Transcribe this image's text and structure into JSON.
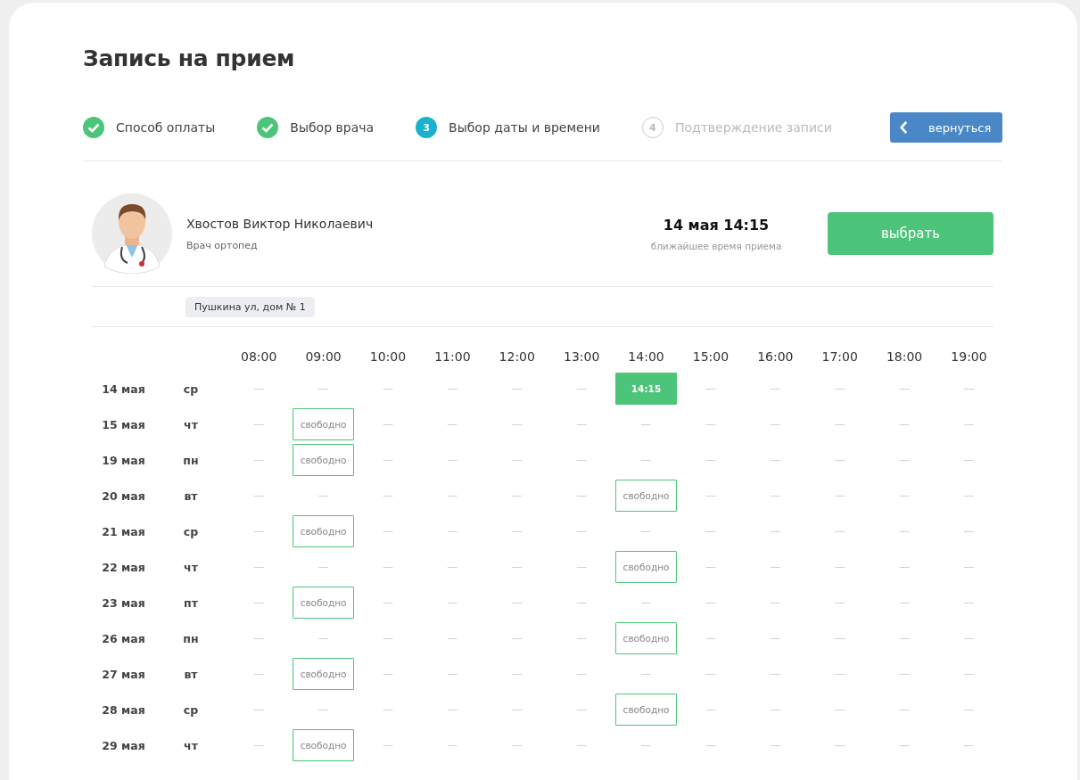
{
  "title": "Запись на прием",
  "steps": [
    {
      "label": "Способ оплаты",
      "kind": "done"
    },
    {
      "label": "Выбор врача",
      "kind": "done"
    },
    {
      "label": "Выбор даты и времени",
      "kind": "current",
      "number": "3"
    },
    {
      "label": "Подтверждение записи",
      "kind": "upcoming",
      "number": "4"
    }
  ],
  "back_button": "вернуться",
  "doctor": {
    "name": "Хвостов Виктор Николаевич",
    "specialty": "Врач ортопед",
    "nearest_time": "14 мая 14:15",
    "nearest_caption": "ближайшее время приема",
    "select_button": "выбрать",
    "address": "Пушкина ул, дом № 1"
  },
  "schedule": {
    "hours": [
      "08:00",
      "09:00",
      "10:00",
      "11:00",
      "12:00",
      "13:00",
      "14:00",
      "15:00",
      "16:00",
      "17:00",
      "18:00",
      "19:00"
    ],
    "rows": [
      {
        "date": "14 мая",
        "weekday": "ср",
        "cells": [
          {
            "kind": "empty",
            "text": "—"
          },
          {
            "kind": "empty",
            "text": "—"
          },
          {
            "kind": "empty",
            "text": "—"
          },
          {
            "kind": "empty",
            "text": "—"
          },
          {
            "kind": "empty",
            "text": "—"
          },
          {
            "kind": "empty",
            "text": "—"
          },
          {
            "kind": "slot",
            "text": "14:15",
            "selected": true
          },
          {
            "kind": "empty",
            "text": "—"
          },
          {
            "kind": "empty",
            "text": "—"
          },
          {
            "kind": "empty",
            "text": "—"
          },
          {
            "kind": "empty",
            "text": "—"
          },
          {
            "kind": "empty",
            "text": "—"
          }
        ]
      },
      {
        "date": "15 мая",
        "weekday": "чт",
        "cells": [
          {
            "kind": "empty",
            "text": "—"
          },
          {
            "kind": "slot",
            "text": "свободно",
            "selected": false
          },
          {
            "kind": "empty",
            "text": "—"
          },
          {
            "kind": "empty",
            "text": "—"
          },
          {
            "kind": "empty",
            "text": "—"
          },
          {
            "kind": "empty",
            "text": "—"
          },
          {
            "kind": "empty",
            "text": "—"
          },
          {
            "kind": "empty",
            "text": "—"
          },
          {
            "kind": "empty",
            "text": "—"
          },
          {
            "kind": "empty",
            "text": "—"
          },
          {
            "kind": "empty",
            "text": "—"
          },
          {
            "kind": "empty",
            "text": "—"
          }
        ]
      },
      {
        "date": "19 мая",
        "weekday": "пн",
        "cells": [
          {
            "kind": "empty",
            "text": "—"
          },
          {
            "kind": "slot",
            "text": "свободно",
            "selected": false
          },
          {
            "kind": "empty",
            "text": "—"
          },
          {
            "kind": "empty",
            "text": "—"
          },
          {
            "kind": "empty",
            "text": "—"
          },
          {
            "kind": "empty",
            "text": "—"
          },
          {
            "kind": "empty",
            "text": "—"
          },
          {
            "kind": "empty",
            "text": "—"
          },
          {
            "kind": "empty",
            "text": "—"
          },
          {
            "kind": "empty",
            "text": "—"
          },
          {
            "kind": "empty",
            "text": "—"
          },
          {
            "kind": "empty",
            "text": "—"
          }
        ]
      },
      {
        "date": "20 мая",
        "weekday": "вт",
        "cells": [
          {
            "kind": "empty",
            "text": "—"
          },
          {
            "kind": "empty",
            "text": "—"
          },
          {
            "kind": "empty",
            "text": "—"
          },
          {
            "kind": "empty",
            "text": "—"
          },
          {
            "kind": "empty",
            "text": "—"
          },
          {
            "kind": "empty",
            "text": "—"
          },
          {
            "kind": "slot",
            "text": "свободно",
            "selected": false
          },
          {
            "kind": "empty",
            "text": "—"
          },
          {
            "kind": "empty",
            "text": "—"
          },
          {
            "kind": "empty",
            "text": "—"
          },
          {
            "kind": "empty",
            "text": "—"
          },
          {
            "kind": "empty",
            "text": "—"
          }
        ]
      },
      {
        "date": "21 мая",
        "weekday": "ср",
        "cells": [
          {
            "kind": "empty",
            "text": "—"
          },
          {
            "kind": "slot",
            "text": "свободно",
            "selected": false
          },
          {
            "kind": "empty",
            "text": "—"
          },
          {
            "kind": "empty",
            "text": "—"
          },
          {
            "kind": "empty",
            "text": "—"
          },
          {
            "kind": "empty",
            "text": "—"
          },
          {
            "kind": "empty",
            "text": "—"
          },
          {
            "kind": "empty",
            "text": "—"
          },
          {
            "kind": "empty",
            "text": "—"
          },
          {
            "kind": "empty",
            "text": "—"
          },
          {
            "kind": "empty",
            "text": "—"
          },
          {
            "kind": "empty",
            "text": "—"
          }
        ]
      },
      {
        "date": "22 мая",
        "weekday": "чт",
        "cells": [
          {
            "kind": "empty",
            "text": "—"
          },
          {
            "kind": "empty",
            "text": "—"
          },
          {
            "kind": "empty",
            "text": "—"
          },
          {
            "kind": "empty",
            "text": "—"
          },
          {
            "kind": "empty",
            "text": "—"
          },
          {
            "kind": "empty",
            "text": "—"
          },
          {
            "kind": "slot",
            "text": "свободно",
            "selected": false
          },
          {
            "kind": "empty",
            "text": "—"
          },
          {
            "kind": "empty",
            "text": "—"
          },
          {
            "kind": "empty",
            "text": "—"
          },
          {
            "kind": "empty",
            "text": "—"
          },
          {
            "kind": "empty",
            "text": "—"
          }
        ]
      },
      {
        "date": "23 мая",
        "weekday": "пт",
        "cells": [
          {
            "kind": "empty",
            "text": "—"
          },
          {
            "kind": "slot",
            "text": "свободно",
            "selected": false
          },
          {
            "kind": "empty",
            "text": "—"
          },
          {
            "kind": "empty",
            "text": "—"
          },
          {
            "kind": "empty",
            "text": "—"
          },
          {
            "kind": "empty",
            "text": "—"
          },
          {
            "kind": "empty",
            "text": "—"
          },
          {
            "kind": "empty",
            "text": "—"
          },
          {
            "kind": "empty",
            "text": "—"
          },
          {
            "kind": "empty",
            "text": "—"
          },
          {
            "kind": "empty",
            "text": "—"
          },
          {
            "kind": "empty",
            "text": "—"
          }
        ]
      },
      {
        "date": "26 мая",
        "weekday": "пн",
        "cells": [
          {
            "kind": "empty",
            "text": "—"
          },
          {
            "kind": "empty",
            "text": "—"
          },
          {
            "kind": "empty",
            "text": "—"
          },
          {
            "kind": "empty",
            "text": "—"
          },
          {
            "kind": "empty",
            "text": "—"
          },
          {
            "kind": "empty",
            "text": "—"
          },
          {
            "kind": "slot",
            "text": "свободно",
            "selected": false
          },
          {
            "kind": "empty",
            "text": "—"
          },
          {
            "kind": "empty",
            "text": "—"
          },
          {
            "kind": "empty",
            "text": "—"
          },
          {
            "kind": "empty",
            "text": "—"
          },
          {
            "kind": "empty",
            "text": "—"
          }
        ]
      },
      {
        "date": "27 мая",
        "weekday": "вт",
        "cells": [
          {
            "kind": "empty",
            "text": "—"
          },
          {
            "kind": "slot",
            "text": "свободно",
            "selected": false
          },
          {
            "kind": "empty",
            "text": "—"
          },
          {
            "kind": "empty",
            "text": "—"
          },
          {
            "kind": "empty",
            "text": "—"
          },
          {
            "kind": "empty",
            "text": "—"
          },
          {
            "kind": "empty",
            "text": "—"
          },
          {
            "kind": "empty",
            "text": "—"
          },
          {
            "kind": "empty",
            "text": "—"
          },
          {
            "kind": "empty",
            "text": "—"
          },
          {
            "kind": "empty",
            "text": "—"
          },
          {
            "kind": "empty",
            "text": "—"
          }
        ]
      },
      {
        "date": "28 мая",
        "weekday": "ср",
        "cells": [
          {
            "kind": "empty",
            "text": "—"
          },
          {
            "kind": "empty",
            "text": "—"
          },
          {
            "kind": "empty",
            "text": "—"
          },
          {
            "kind": "empty",
            "text": "—"
          },
          {
            "kind": "empty",
            "text": "—"
          },
          {
            "kind": "empty",
            "text": "—"
          },
          {
            "kind": "slot",
            "text": "свободно",
            "selected": false
          },
          {
            "kind": "empty",
            "text": "—"
          },
          {
            "kind": "empty",
            "text": "—"
          },
          {
            "kind": "empty",
            "text": "—"
          },
          {
            "kind": "empty",
            "text": "—"
          },
          {
            "kind": "empty",
            "text": "—"
          }
        ]
      },
      {
        "date": "29 мая",
        "weekday": "чт",
        "cells": [
          {
            "kind": "empty",
            "text": "—"
          },
          {
            "kind": "slot",
            "text": "свободно",
            "selected": false
          },
          {
            "kind": "empty",
            "text": "—"
          },
          {
            "kind": "empty",
            "text": "—"
          },
          {
            "kind": "empty",
            "text": "—"
          },
          {
            "kind": "empty",
            "text": "—"
          },
          {
            "kind": "empty",
            "text": "—"
          },
          {
            "kind": "empty",
            "text": "—"
          },
          {
            "kind": "empty",
            "text": "—"
          },
          {
            "kind": "empty",
            "text": "—"
          },
          {
            "kind": "empty",
            "text": "—"
          },
          {
            "kind": "empty",
            "text": "—"
          }
        ]
      }
    ]
  }
}
